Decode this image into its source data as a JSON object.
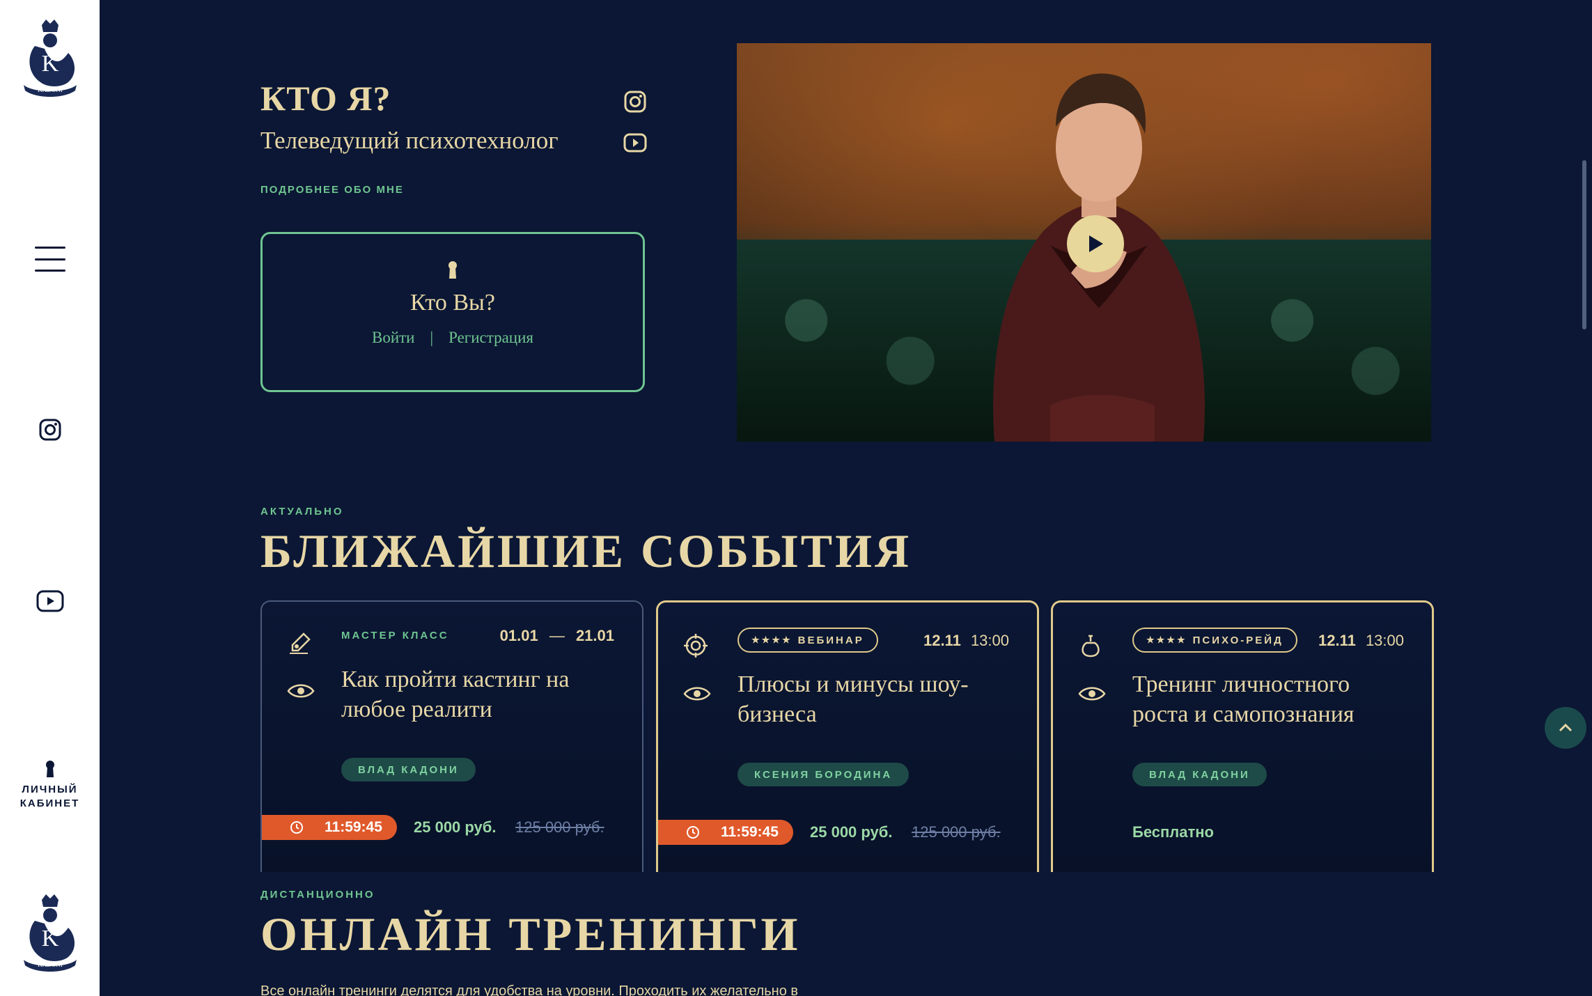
{
  "brand": {
    "logo_text": "KADONI"
  },
  "sidebar": {
    "menu_icon": "burger-menu-icon",
    "instagram_icon": "instagram-icon",
    "youtube_icon": "youtube-icon",
    "cabinet_line1": "ЛИЧНЫЙ",
    "cabinet_line2": "КАБИНЕТ"
  },
  "about": {
    "title": "КТО Я?",
    "subtitle": "Телеведущий психотехнолог",
    "more_link": "ПОДРОБНЕЕ ОБО МНЕ"
  },
  "login": {
    "title": "Кто Вы?",
    "login_link": "Войти",
    "separator": "|",
    "register_link": "Регистрация"
  },
  "events": {
    "kicker": "АКТУАЛЬНО",
    "title": "БЛИЖАЙШИЕ СОБЫТИЯ",
    "cards": [
      {
        "type": "МАСТЕР КЛАСС",
        "stars": "",
        "date_from": "01.01",
        "date_dash": "—",
        "date_to": "21.01",
        "title": "Как пройти кастинг на любое реалити",
        "author": "ВЛАД КАДОНИ",
        "timer": "11:59:45",
        "price": "25 000 руб.",
        "old_price": "125 000 руб."
      },
      {
        "type": "ВЕБИНАР",
        "stars": "★★★★",
        "date": "12.11",
        "time": "13:00",
        "title": "Плюсы и минусы шоу-бизнеса",
        "author": "КСЕНИЯ БОРОДИНА",
        "timer": "11:59:45",
        "price": "25 000 руб.",
        "old_price": "125 000 руб."
      },
      {
        "type": "ПСИХО-РЕЙД",
        "stars": "★★★★",
        "date": "12.11",
        "time": "13:00",
        "title": "Тренинг личностного роста и самопознания",
        "author": "ВЛАД КАДОНИ",
        "price_free": "Бесплатно"
      }
    ]
  },
  "online": {
    "kicker": "ДИСТАНЦИОННО",
    "title": "ОНЛАЙН ТРЕНИНГИ",
    "description": "Все онлайн тренинги делятся для удобства на уровни. Проходить их желательно в"
  },
  "colors": {
    "background": "#0b1734",
    "accent_gold": "#e8d7a6",
    "accent_green": "#6fc591",
    "timer_orange": "#e0592b"
  }
}
